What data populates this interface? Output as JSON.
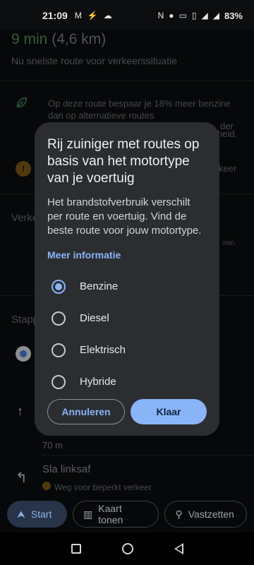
{
  "status": {
    "time": "21:09",
    "battery": "83%"
  },
  "route": {
    "duration": "9 min",
    "distance": "(4,6 km)",
    "subtitle": "Nu snelste route voor verkeerssituatie"
  },
  "background": {
    "fuel_note": "Op deze route bespaar je 18% meer benzine dan op alternatieve routes",
    "fuel_note_tail1": "der",
    "fuel_note_tail2": "heid.",
    "warning_tail": "keer",
    "section_partial": "Verke",
    "dashes_tail": "min.",
    "steps_partial": "Stapp",
    "distance_step": "70 m",
    "turn_label": "Sla linksaf",
    "restricted": "Weg voor beperkt verkeer"
  },
  "dialog": {
    "title": "Rij zuiniger met routes op basis van het motortype van je voertuig",
    "body": "Het brandstofverbruik verschilt per route en voertuig. Vind de beste route voor jouw motortype.",
    "link": "Meer informatie",
    "options": [
      {
        "label": "Benzine",
        "selected": true
      },
      {
        "label": "Diesel",
        "selected": false
      },
      {
        "label": "Elektrisch",
        "selected": false
      },
      {
        "label": "Hybride",
        "selected": false
      }
    ],
    "cancel": "Annuleren",
    "ok": "Klaar"
  },
  "bottom": {
    "start": "Start",
    "show_map": "Kaart tonen",
    "pin": "Vastzetten"
  },
  "colors": {
    "accent": "#8ab4f8",
    "dialog_bg": "#2b2d31",
    "route_green": "#4a8f5c"
  }
}
